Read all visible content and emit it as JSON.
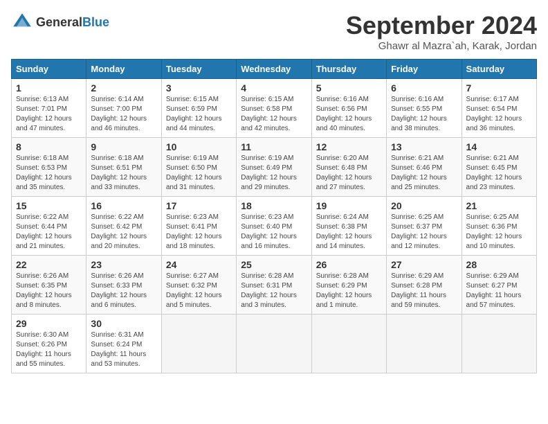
{
  "header": {
    "logo_general": "General",
    "logo_blue": "Blue",
    "month": "September 2024",
    "location": "Ghawr al Mazra`ah, Karak, Jordan"
  },
  "days_of_week": [
    "Sunday",
    "Monday",
    "Tuesday",
    "Wednesday",
    "Thursday",
    "Friday",
    "Saturday"
  ],
  "weeks": [
    [
      {
        "day": "1",
        "sunrise": "6:13 AM",
        "sunset": "7:01 PM",
        "daylight": "12 hours and 47 minutes."
      },
      {
        "day": "2",
        "sunrise": "6:14 AM",
        "sunset": "7:00 PM",
        "daylight": "12 hours and 46 minutes."
      },
      {
        "day": "3",
        "sunrise": "6:15 AM",
        "sunset": "6:59 PM",
        "daylight": "12 hours and 44 minutes."
      },
      {
        "day": "4",
        "sunrise": "6:15 AM",
        "sunset": "6:58 PM",
        "daylight": "12 hours and 42 minutes."
      },
      {
        "day": "5",
        "sunrise": "6:16 AM",
        "sunset": "6:56 PM",
        "daylight": "12 hours and 40 minutes."
      },
      {
        "day": "6",
        "sunrise": "6:16 AM",
        "sunset": "6:55 PM",
        "daylight": "12 hours and 38 minutes."
      },
      {
        "day": "7",
        "sunrise": "6:17 AM",
        "sunset": "6:54 PM",
        "daylight": "12 hours and 36 minutes."
      }
    ],
    [
      {
        "day": "8",
        "sunrise": "6:18 AM",
        "sunset": "6:53 PM",
        "daylight": "12 hours and 35 minutes."
      },
      {
        "day": "9",
        "sunrise": "6:18 AM",
        "sunset": "6:51 PM",
        "daylight": "12 hours and 33 minutes."
      },
      {
        "day": "10",
        "sunrise": "6:19 AM",
        "sunset": "6:50 PM",
        "daylight": "12 hours and 31 minutes."
      },
      {
        "day": "11",
        "sunrise": "6:19 AM",
        "sunset": "6:49 PM",
        "daylight": "12 hours and 29 minutes."
      },
      {
        "day": "12",
        "sunrise": "6:20 AM",
        "sunset": "6:48 PM",
        "daylight": "12 hours and 27 minutes."
      },
      {
        "day": "13",
        "sunrise": "6:21 AM",
        "sunset": "6:46 PM",
        "daylight": "12 hours and 25 minutes."
      },
      {
        "day": "14",
        "sunrise": "6:21 AM",
        "sunset": "6:45 PM",
        "daylight": "12 hours and 23 minutes."
      }
    ],
    [
      {
        "day": "15",
        "sunrise": "6:22 AM",
        "sunset": "6:44 PM",
        "daylight": "12 hours and 21 minutes."
      },
      {
        "day": "16",
        "sunrise": "6:22 AM",
        "sunset": "6:42 PM",
        "daylight": "12 hours and 20 minutes."
      },
      {
        "day": "17",
        "sunrise": "6:23 AM",
        "sunset": "6:41 PM",
        "daylight": "12 hours and 18 minutes."
      },
      {
        "day": "18",
        "sunrise": "6:23 AM",
        "sunset": "6:40 PM",
        "daylight": "12 hours and 16 minutes."
      },
      {
        "day": "19",
        "sunrise": "6:24 AM",
        "sunset": "6:38 PM",
        "daylight": "12 hours and 14 minutes."
      },
      {
        "day": "20",
        "sunrise": "6:25 AM",
        "sunset": "6:37 PM",
        "daylight": "12 hours and 12 minutes."
      },
      {
        "day": "21",
        "sunrise": "6:25 AM",
        "sunset": "6:36 PM",
        "daylight": "12 hours and 10 minutes."
      }
    ],
    [
      {
        "day": "22",
        "sunrise": "6:26 AM",
        "sunset": "6:35 PM",
        "daylight": "12 hours and 8 minutes."
      },
      {
        "day": "23",
        "sunrise": "6:26 AM",
        "sunset": "6:33 PM",
        "daylight": "12 hours and 6 minutes."
      },
      {
        "day": "24",
        "sunrise": "6:27 AM",
        "sunset": "6:32 PM",
        "daylight": "12 hours and 5 minutes."
      },
      {
        "day": "25",
        "sunrise": "6:28 AM",
        "sunset": "6:31 PM",
        "daylight": "12 hours and 3 minutes."
      },
      {
        "day": "26",
        "sunrise": "6:28 AM",
        "sunset": "6:29 PM",
        "daylight": "12 hours and 1 minute."
      },
      {
        "day": "27",
        "sunrise": "6:29 AM",
        "sunset": "6:28 PM",
        "daylight": "11 hours and 59 minutes."
      },
      {
        "day": "28",
        "sunrise": "6:29 AM",
        "sunset": "6:27 PM",
        "daylight": "11 hours and 57 minutes."
      }
    ],
    [
      {
        "day": "29",
        "sunrise": "6:30 AM",
        "sunset": "6:26 PM",
        "daylight": "11 hours and 55 minutes."
      },
      {
        "day": "30",
        "sunrise": "6:31 AM",
        "sunset": "6:24 PM",
        "daylight": "11 hours and 53 minutes."
      },
      {
        "day": "",
        "sunrise": "",
        "sunset": "",
        "daylight": ""
      },
      {
        "day": "",
        "sunrise": "",
        "sunset": "",
        "daylight": ""
      },
      {
        "day": "",
        "sunrise": "",
        "sunset": "",
        "daylight": ""
      },
      {
        "day": "",
        "sunrise": "",
        "sunset": "",
        "daylight": ""
      },
      {
        "day": "",
        "sunrise": "",
        "sunset": "",
        "daylight": ""
      }
    ]
  ]
}
